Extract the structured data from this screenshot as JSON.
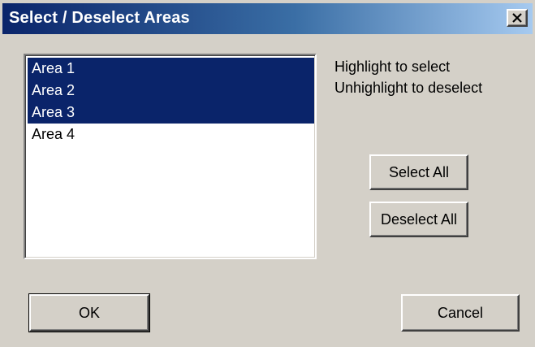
{
  "window": {
    "title": "Select / Deselect Areas",
    "close_icon": "close-icon"
  },
  "area_list": {
    "items": [
      {
        "label": "Area 1",
        "selected": true
      },
      {
        "label": "Area 2",
        "selected": true
      },
      {
        "label": "Area 3",
        "selected": true
      },
      {
        "label": "Area 4",
        "selected": false
      }
    ]
  },
  "hints": {
    "line1": "Highlight to select",
    "line2": "Unhighlight to deselect"
  },
  "buttons": {
    "select_all": "Select All",
    "deselect_all": "Deselect All",
    "ok": "OK",
    "cancel": "Cancel"
  },
  "colors": {
    "dialog_bg": "#d4d0c8",
    "selection_bg": "#0a246a",
    "title_gradient_start": "#0a246a",
    "title_gradient_end": "#a6caf0"
  }
}
